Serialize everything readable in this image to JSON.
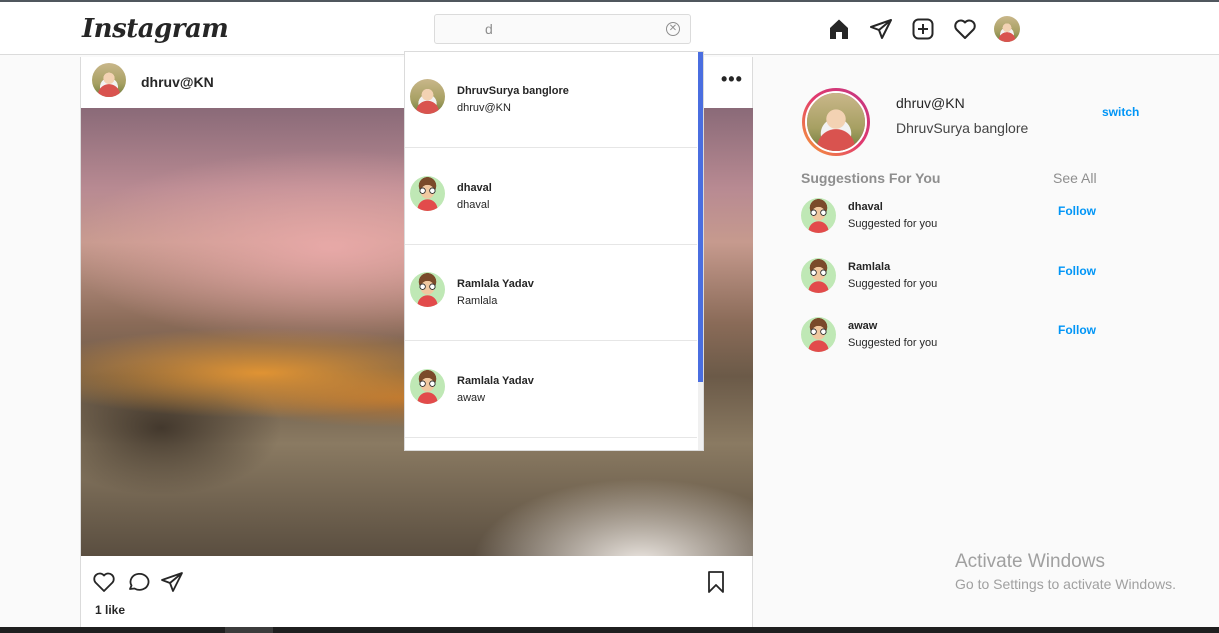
{
  "header": {
    "logo": "Instagram",
    "search": {
      "value": "d",
      "placeholder": "Search"
    },
    "icons": [
      "home-icon",
      "direct-icon",
      "new-post-icon",
      "activity-icon"
    ]
  },
  "post": {
    "username": "dhruv@KN",
    "more": "•••",
    "likes": "1 like"
  },
  "dropdown": {
    "results": [
      {
        "name": "DhruvSurya banglore",
        "sub": "dhruv@KN"
      },
      {
        "name": "dhaval",
        "sub": "dhaval"
      },
      {
        "name": "Ramlala Yadav",
        "sub": "Ramlala"
      },
      {
        "name": "Ramlala Yadav",
        "sub": "awaw"
      }
    ]
  },
  "profile": {
    "username": "dhruv@KN",
    "full_name": "DhruvSurya banglore",
    "switch": "switch"
  },
  "suggestions": {
    "title": "Suggestions For You",
    "see_all": "See All",
    "items": [
      {
        "name": "dhaval",
        "sub": "Suggested for you",
        "action": "Follow"
      },
      {
        "name": "Ramlala",
        "sub": "Suggested for you",
        "action": "Follow"
      },
      {
        "name": "awaw",
        "sub": "Suggested for you",
        "action": "Follow"
      }
    ]
  },
  "watermark": {
    "line1": "Activate Windows",
    "line2": "Go to Settings to activate Windows."
  },
  "colors": {
    "link_blue": "#0095f6",
    "muted": "#8e8e8e",
    "scroll_thumb": "#4a6ee0"
  }
}
